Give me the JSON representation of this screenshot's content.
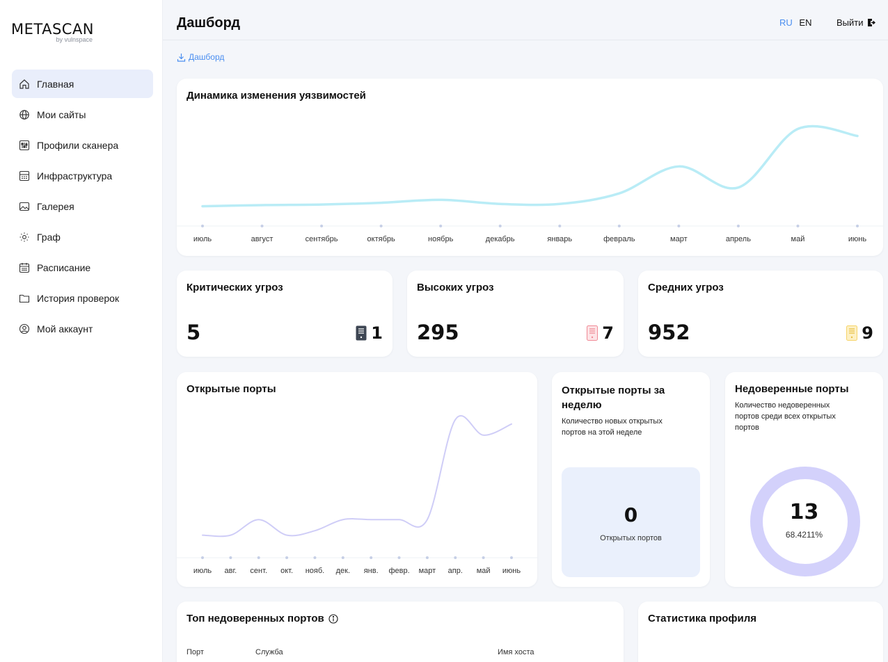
{
  "app": {
    "logo": "METASCAN",
    "logo_sub": "by vulnspace"
  },
  "sidebar": {
    "items": [
      {
        "label": "Главная",
        "icon": "home-icon",
        "active": true
      },
      {
        "label": "Мои сайты",
        "icon": "globe-icon"
      },
      {
        "label": "Профили сканера",
        "icon": "sliders-icon"
      },
      {
        "label": "Инфраструктура",
        "icon": "server-icon"
      },
      {
        "label": "Галерея",
        "icon": "image-icon"
      },
      {
        "label": "Граф",
        "icon": "graph-icon"
      },
      {
        "label": "Расписание",
        "icon": "calendar-icon"
      },
      {
        "label": "История проверок",
        "icon": "folder-icon"
      },
      {
        "label": "Мой аккаунт",
        "icon": "user-icon"
      }
    ]
  },
  "header": {
    "title": "Дашборд",
    "lang_ru": "RU",
    "lang_en": "EN",
    "logout": "Выйти"
  },
  "breadcrumb": {
    "label": "Дашборд"
  },
  "colors": {
    "accent": "#4a8ef0",
    "vuln_line": "#b9ecf6",
    "ports_line": "#cfcdf7",
    "donut": "#d3d1fb",
    "critical": "#3e4653",
    "high": "#f08a96",
    "medium": "#f7d46a"
  },
  "vuln_chart": {
    "title": "Динамика изменения уязвимостей",
    "chart_data": {
      "type": "line",
      "categories": [
        "июль",
        "август",
        "сентябрь",
        "октябрь",
        "ноябрь",
        "декабрь",
        "январь",
        "февраль",
        "март",
        "апрель",
        "май",
        "июнь"
      ],
      "values": [
        2,
        3,
        3.5,
        5,
        7.5,
        4,
        4,
        13,
        36,
        18,
        68,
        62
      ]
    }
  },
  "stats": [
    {
      "title": "Критических угроз",
      "value": "5",
      "count": "1",
      "icon": "critical-icon"
    },
    {
      "title": "Высоких угроз",
      "value": "295",
      "count": "7",
      "icon": "high-icon"
    },
    {
      "title": "Средних угроз",
      "value": "952",
      "count": "9",
      "icon": "medium-icon"
    }
  ],
  "ports_chart": {
    "title": "Открытые порты",
    "chart_data": {
      "type": "line",
      "categories": [
        "июль",
        "авг.",
        "сент.",
        "окт.",
        "нояб.",
        "дек.",
        "янв.",
        "февр.",
        "март",
        "апр.",
        "май",
        "июнь"
      ],
      "values": [
        8,
        8,
        15,
        8,
        10,
        15,
        15,
        15,
        15,
        60,
        53,
        58
      ]
    }
  },
  "weekly": {
    "title_line1": "Открытые порты за",
    "title_line2": "неделю",
    "desc_line1": "Количество новых открытых",
    "desc_line2": "портов на этой неделе",
    "value": "0",
    "label": "Открытых портов"
  },
  "untrusted": {
    "title": "Недоверенные порты",
    "desc_line1": "Количество недоверенных",
    "desc_line2": "портов среди всех открытых",
    "desc_line3": "портов",
    "value": "13",
    "percent": "68.4211%"
  },
  "top_ports": {
    "title": "Топ недоверенных портов",
    "columns": [
      "Порт",
      "Служба",
      "Имя хоста"
    ]
  },
  "profile_stats": {
    "title": "Статистика профиля"
  }
}
